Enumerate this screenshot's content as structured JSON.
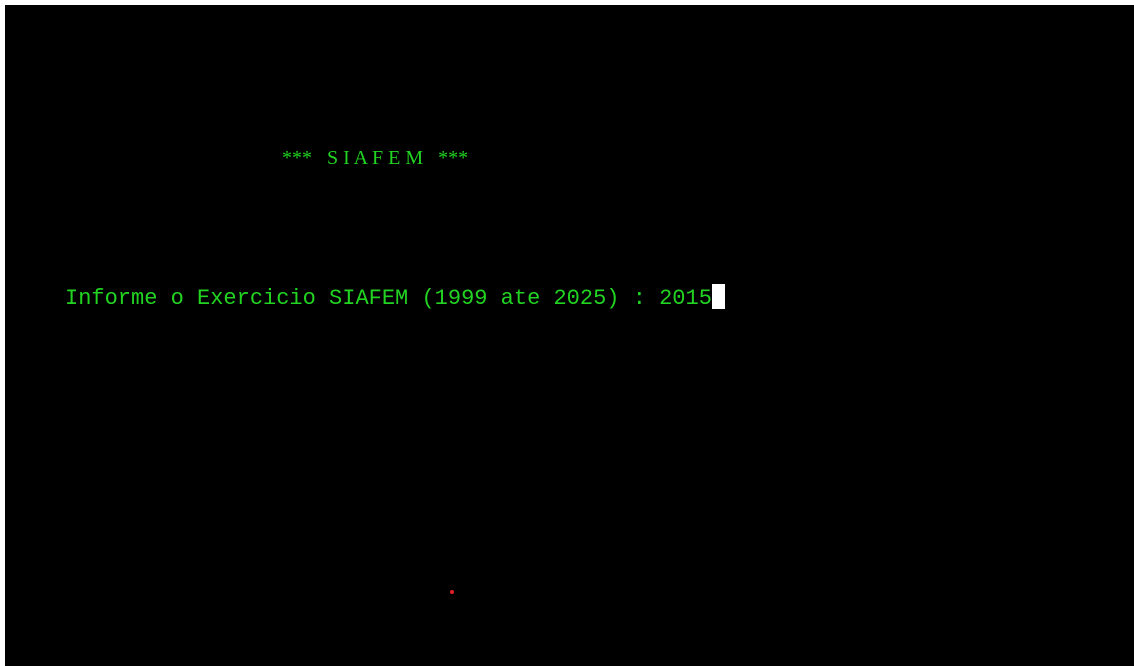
{
  "screen": {
    "title": "***   S I A F E M   ***",
    "prompt_label": "Informe o Exercicio SIAFEM (1999 ate 2025) : ",
    "input_value": "2015"
  },
  "colors": {
    "background": "#000000",
    "text": "#22d422",
    "cursor": "#ffffff",
    "marker": "#e02020"
  }
}
